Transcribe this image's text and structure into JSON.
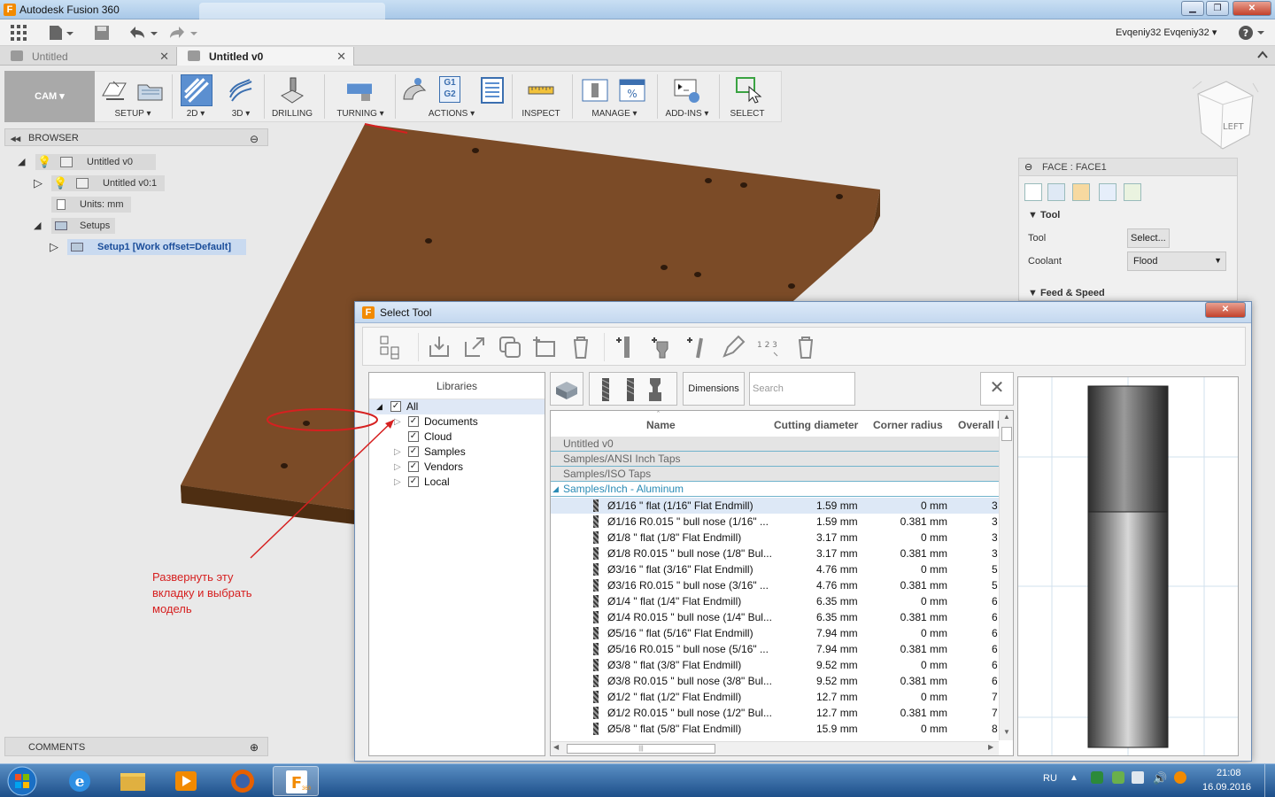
{
  "window": {
    "title": "Autodesk Fusion 360",
    "app_initial": "F"
  },
  "user": {
    "name": "Evqeniy32 Evqeniy32"
  },
  "tabs": [
    {
      "label": "Untitled",
      "close": "✕"
    },
    {
      "label": "Untitled v0",
      "close": "✕"
    }
  ],
  "ribbon": {
    "workspace": "CAM ▾",
    "groups": [
      "SETUP ▾",
      "2D ▾",
      "3D ▾",
      "DRILLING",
      "TURNING ▾",
      "ACTIONS ▾",
      "INSPECT",
      "MANAGE ▾",
      "ADD-INS ▾",
      "SELECT"
    ],
    "actions_icon_text": [
      "G1",
      "G2"
    ]
  },
  "viewcube": {
    "label": "LEFT"
  },
  "browser": {
    "title": "BROWSER",
    "nodes": [
      "Untitled v0",
      "Untitled v0:1",
      "Units: mm",
      "Setups",
      "Setup1 [Work offset=Default]"
    ]
  },
  "comments": {
    "title": "COMMENTS"
  },
  "face_panel": {
    "title": "FACE : FACE1",
    "section_tool": "Tool",
    "tool_label": "Tool",
    "tool_value": "Select...",
    "coolant_label": "Coolant",
    "coolant_value": "Flood",
    "section_feed": "Feed & Speed"
  },
  "dialog": {
    "title": "Select Tool",
    "close": "✕",
    "numbering_icon": "1 2 3",
    "libraries": {
      "header": "Libraries",
      "items": [
        "All",
        "Documents",
        "Cloud",
        "Samples",
        "Vendors",
        "Local"
      ]
    },
    "filter": {
      "dimensions_label": "Dimensions",
      "search_placeholder": "Search",
      "clear": "✕"
    },
    "columns": [
      "Name",
      "Cutting diameter",
      "Corner radius",
      "Overall l"
    ],
    "groups": [
      "Untitled v0",
      "Samples/ANSI Inch Taps",
      "Samples/ISO Taps",
      "Samples/Inch - Aluminum"
    ],
    "rows": [
      {
        "name": "Ø1/16 \" flat (1/16\" Flat Endmill)",
        "diameter": "1.59 mm",
        "radius": "0 mm",
        "overall": "3"
      },
      {
        "name": "Ø1/16 R0.015 \" bull nose (1/16\" ...",
        "diameter": "1.59 mm",
        "radius": "0.381 mm",
        "overall": "3"
      },
      {
        "name": "Ø1/8 \" flat (1/8\" Flat Endmill)",
        "diameter": "3.17 mm",
        "radius": "0 mm",
        "overall": "3"
      },
      {
        "name": "Ø1/8 R0.015 \" bull nose (1/8\" Bul...",
        "diameter": "3.17 mm",
        "radius": "0.381 mm",
        "overall": "3"
      },
      {
        "name": "Ø3/16 \" flat (3/16\" Flat Endmill)",
        "diameter": "4.76 mm",
        "radius": "0 mm",
        "overall": "5"
      },
      {
        "name": "Ø3/16 R0.015 \" bull nose (3/16\" ...",
        "diameter": "4.76 mm",
        "radius": "0.381 mm",
        "overall": "5"
      },
      {
        "name": "Ø1/4 \" flat (1/4\" Flat Endmill)",
        "diameter": "6.35 mm",
        "radius": "0 mm",
        "overall": "6"
      },
      {
        "name": "Ø1/4 R0.015 \" bull nose (1/4\" Bul...",
        "diameter": "6.35 mm",
        "radius": "0.381 mm",
        "overall": "6"
      },
      {
        "name": "Ø5/16 \" flat (5/16\" Flat Endmill)",
        "diameter": "7.94 mm",
        "radius": "0 mm",
        "overall": "6"
      },
      {
        "name": "Ø5/16 R0.015 \" bull nose (5/16\" ...",
        "diameter": "7.94 mm",
        "radius": "0.381 mm",
        "overall": "6"
      },
      {
        "name": "Ø3/8 \" flat (3/8\" Flat Endmill)",
        "diameter": "9.52 mm",
        "radius": "0 mm",
        "overall": "6"
      },
      {
        "name": "Ø3/8 R0.015 \" bull nose (3/8\" Bul...",
        "diameter": "9.52 mm",
        "radius": "0.381 mm",
        "overall": "6"
      },
      {
        "name": "Ø1/2 \" flat (1/2\" Flat Endmill)",
        "diameter": "12.7 mm",
        "radius": "0 mm",
        "overall": "7"
      },
      {
        "name": "Ø1/2 R0.015 \" bull nose (1/2\" Bul...",
        "diameter": "12.7 mm",
        "radius": "0.381 mm",
        "overall": "7"
      },
      {
        "name": "Ø5/8 \" flat (5/8\" Flat Endmill)",
        "diameter": "15.9 mm",
        "radius": "0 mm",
        "overall": "8"
      }
    ]
  },
  "annotation": {
    "lines": [
      "Развернуть эту",
      "вкладку и выбрать",
      "модель"
    ]
  },
  "taskbar": {
    "lang": "RU",
    "time": "21:08",
    "date": "16.09.2016",
    "fusion_label": "360"
  },
  "colors": {
    "model_top": "#7b4b27",
    "model_side": "#5e3818",
    "annotation": "#d62020",
    "accent": "#2a8bb5"
  }
}
